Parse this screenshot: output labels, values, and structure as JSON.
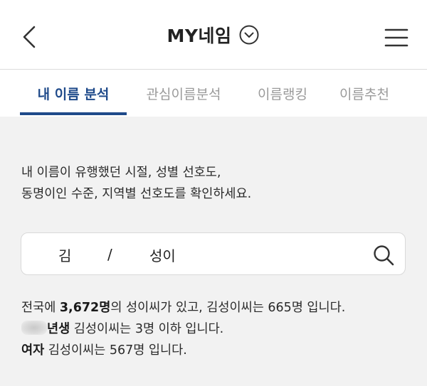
{
  "header": {
    "title": "MY네임",
    "back_icon": "chevron-left-icon",
    "dropdown_icon": "chevron-down-circle-icon",
    "menu_icon": "hamburger-menu-icon"
  },
  "tabs": [
    {
      "label": "내 이름 분석",
      "active": true
    },
    {
      "label": "관심이름분석",
      "active": false
    },
    {
      "label": "이름랭킹",
      "active": false
    },
    {
      "label": "이름추천",
      "active": false
    }
  ],
  "description": {
    "line1": "내 이름이 유행했던 시절, 성별 선호도,",
    "line2": "동명이인 수준, 지역별 선호도를 확인하세요."
  },
  "search": {
    "surname": "김",
    "separator": "/",
    "given_name": "성이",
    "icon": "search-icon"
  },
  "results": {
    "line1_pre": "전국에 ",
    "line1_count": "3,672명",
    "line1_post": "의 성이씨가 있고, 김성이씨는 665명 입니다.",
    "line2_bold": "년생",
    "line2_post": " 김성이씨는 3명 이하 입니다.",
    "line3_bold": "여자",
    "line3_post": " 김성이씨는 567명 입니다."
  },
  "colors": {
    "accent": "#1f4a8a",
    "inactive_tab": "#9a9a9a",
    "background": "#f2f2f2"
  }
}
